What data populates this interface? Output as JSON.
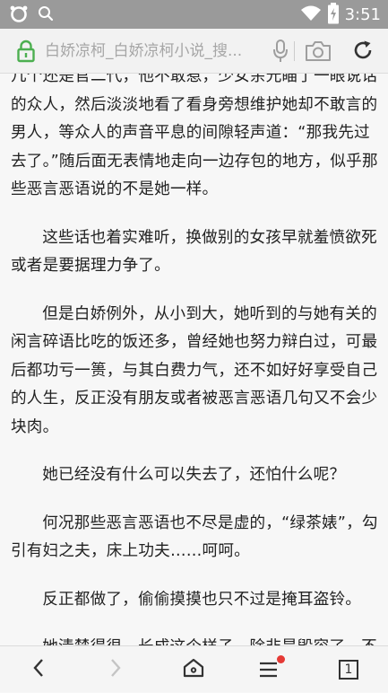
{
  "status_bar": {
    "time": "3:51",
    "icons": [
      "app-ring-icon",
      "search-icon",
      "wifi-icon",
      "battery-charging-icon"
    ]
  },
  "url_bar": {
    "url_text": "白娇凉柯_白娇凉柯小说_搜...",
    "icons": [
      "lock-icon",
      "microphone-icon",
      "camera-icon",
      "refresh-icon"
    ]
  },
  "article": {
    "paragraphs": [
      {
        "text": "几个还是官二代，他不敢惹，少女余光瞄了一眼说话的众人，然后淡淡地看了看身旁想维护她却不敢言的男人，等众人的声音平息的间隙轻声道：“那我先过去了。”随后面无表情地走向一边存包的地方，似乎那些恶言恶语说的不是她一样。",
        "continued": true
      },
      {
        "text": "这些话也着实难听，换做别的女孩早就羞愤欲死或者是要据理力争了。",
        "continued": false
      },
      {
        "text": "但是白娇例外，从小到大，她听到的与她有关的闲言碎语比吃的饭还多，曾经她也努力辩白过，可最后都功亏一篑，与其白费力气，还不如好好享受自己的人生，反正没有朋友或者被恶言恶语几句又不会少块肉。",
        "continued": false
      },
      {
        "text": "她已经没有什么可以失去了，还怕什么呢？",
        "continued": false
      },
      {
        "text": "何况那些恶言恶语也不尽是虚的，“绿茶婊”，勾引有妇之夫，床上功夫……呵呵。",
        "continued": false
      },
      {
        "text": "反正都做了，偷偷摸摸也只不过是掩耳盗铃。",
        "continued": false
      },
      {
        "text": "她清楚得很，长成这个样子，除非是毁容了，不然免不了是要拉仇恨的。可是一个父母尽失，没",
        "continued": false
      }
    ]
  },
  "bottom_nav": {
    "tab_count": "1",
    "menu_has_notification": true,
    "icons": [
      "back-arrow-icon",
      "forward-arrow-icon",
      "home-icon",
      "menu-icon",
      "tabs-icon"
    ]
  },
  "colors": {
    "status_bar_bg": "#9a9a9a",
    "notification_dot": "#e53935",
    "text": "#222222",
    "url_text": "#a6a6a6"
  }
}
